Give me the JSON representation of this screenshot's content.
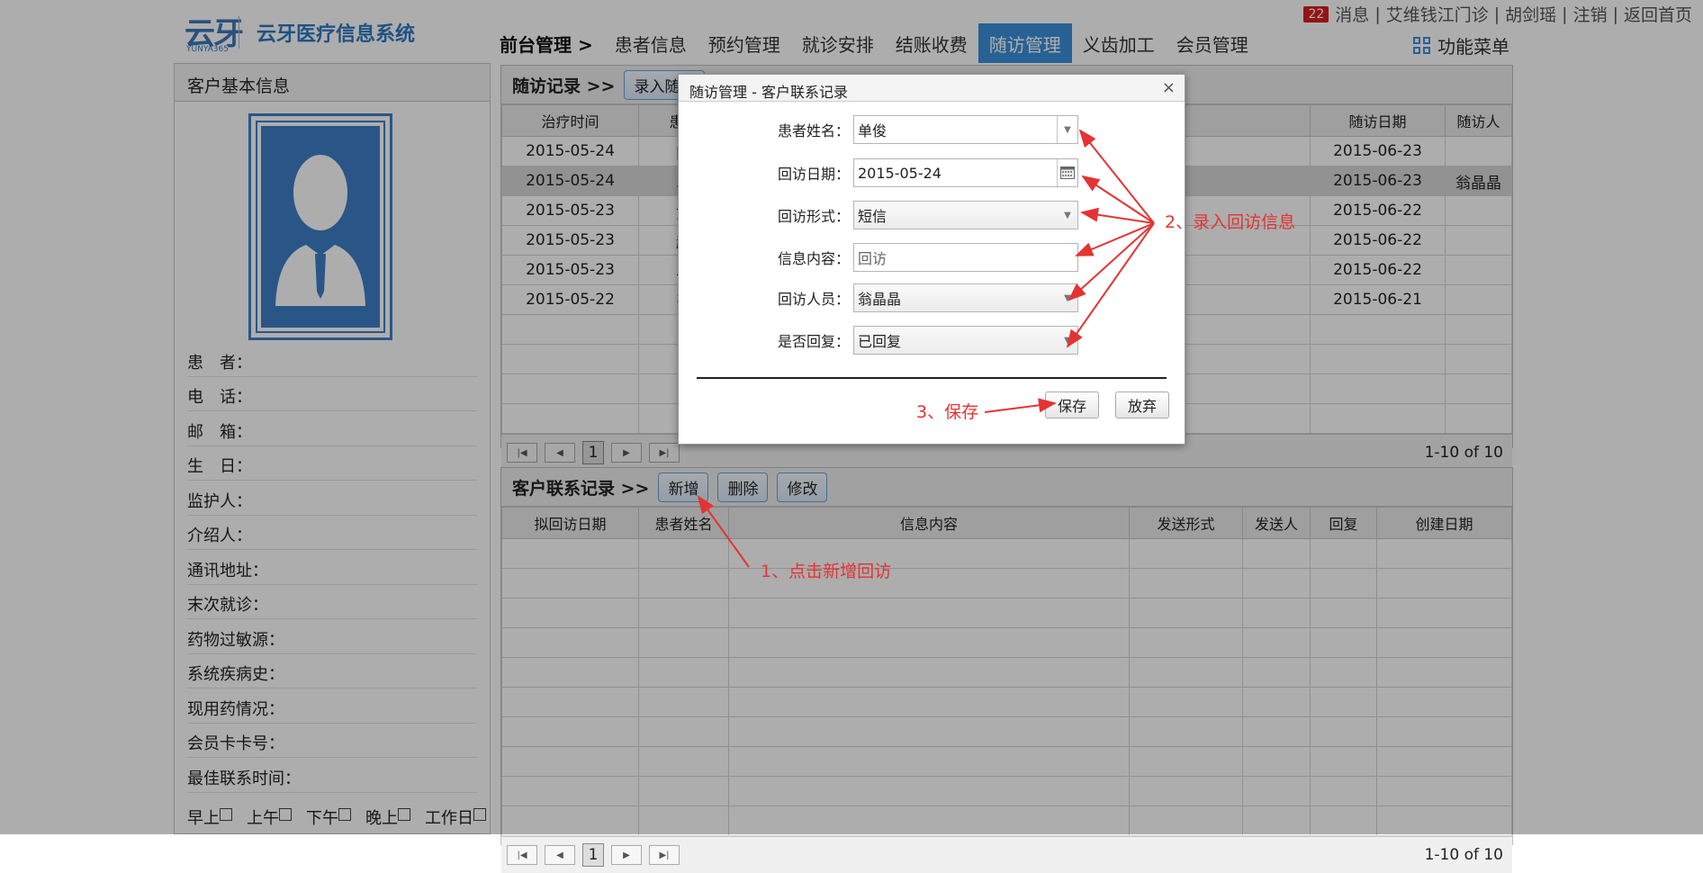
{
  "header": {
    "logo_mark": "云牙",
    "logo_sub": "YUNYA365",
    "app_title": "云牙医疗信息系统",
    "message_count": "22",
    "top_links": [
      "消息",
      "艾维钱江门诊",
      "胡剑瑶",
      "注销",
      "返回首页"
    ],
    "nav_lead": "前台管理 >",
    "nav_items": [
      "患者信息",
      "预约管理",
      "就诊安排",
      "结账收费",
      "随访管理",
      "义齿加工",
      "会员管理"
    ],
    "func_menu": "功能菜单"
  },
  "left": {
    "title": "客户基本信息",
    "fields": [
      "患　者：",
      "电　话：",
      "邮　箱：",
      "生　日：",
      "监护人：",
      "介绍人：",
      "通讯地址：",
      "末次就诊：",
      "药物过敏源：",
      "系统疾病史：",
      "现用药情况：",
      "会员卡卡号：",
      "最佳联系时间："
    ],
    "times": [
      "早上",
      "上午",
      "下午",
      "晚上",
      "工作日"
    ]
  },
  "followup": {
    "title": "随访记录 >>",
    "add_button": "录入随访",
    "columns": [
      "治疗时间",
      "患者",
      "随访日期",
      "随访人"
    ],
    "rows": [
      [
        "2015-05-24",
        "田",
        "2015-06-23",
        ""
      ],
      [
        "2015-05-24",
        "单",
        "2015-06-23",
        "翁晶晶"
      ],
      [
        "2015-05-23",
        "黄",
        "2015-06-22",
        ""
      ],
      [
        "2015-05-23",
        "赵",
        "2015-06-22",
        ""
      ],
      [
        "2015-05-23",
        "马",
        "2015-06-22",
        ""
      ],
      [
        "2015-05-22",
        "张",
        "2015-06-21",
        ""
      ]
    ],
    "page": "1",
    "page_info": "1-10 of 10"
  },
  "contact": {
    "title": "客户联系记录 >>",
    "buttons": [
      "新增",
      "删除",
      "修改"
    ],
    "columns": [
      "拟回访日期",
      "患者姓名",
      "信息内容",
      "发送形式",
      "发送人",
      "回复",
      "创建日期"
    ],
    "page": "1",
    "page_info": "1-10 of 10"
  },
  "dialog": {
    "title": "随访管理 - 客户联系记录",
    "close": "×",
    "fields": [
      {
        "label": "患者姓名：",
        "value": "单俊"
      },
      {
        "label": "回访日期：",
        "value": "2015-05-24"
      },
      {
        "label": "回访形式：",
        "value": "短信"
      },
      {
        "label": "信息内容：",
        "placeholder": "回访"
      },
      {
        "label": "回访人员：",
        "value": "翁晶晶"
      },
      {
        "label": "是否回复：",
        "value": "已回复"
      }
    ],
    "save": "保存",
    "cancel": "放弃"
  },
  "annotations": [
    "1、点击新增回访",
    "2、录入回访信息",
    "3、保存"
  ],
  "colors": {
    "accent": "#3c8fdb",
    "annotation": "#e53333",
    "badge": "#d81e1e"
  }
}
